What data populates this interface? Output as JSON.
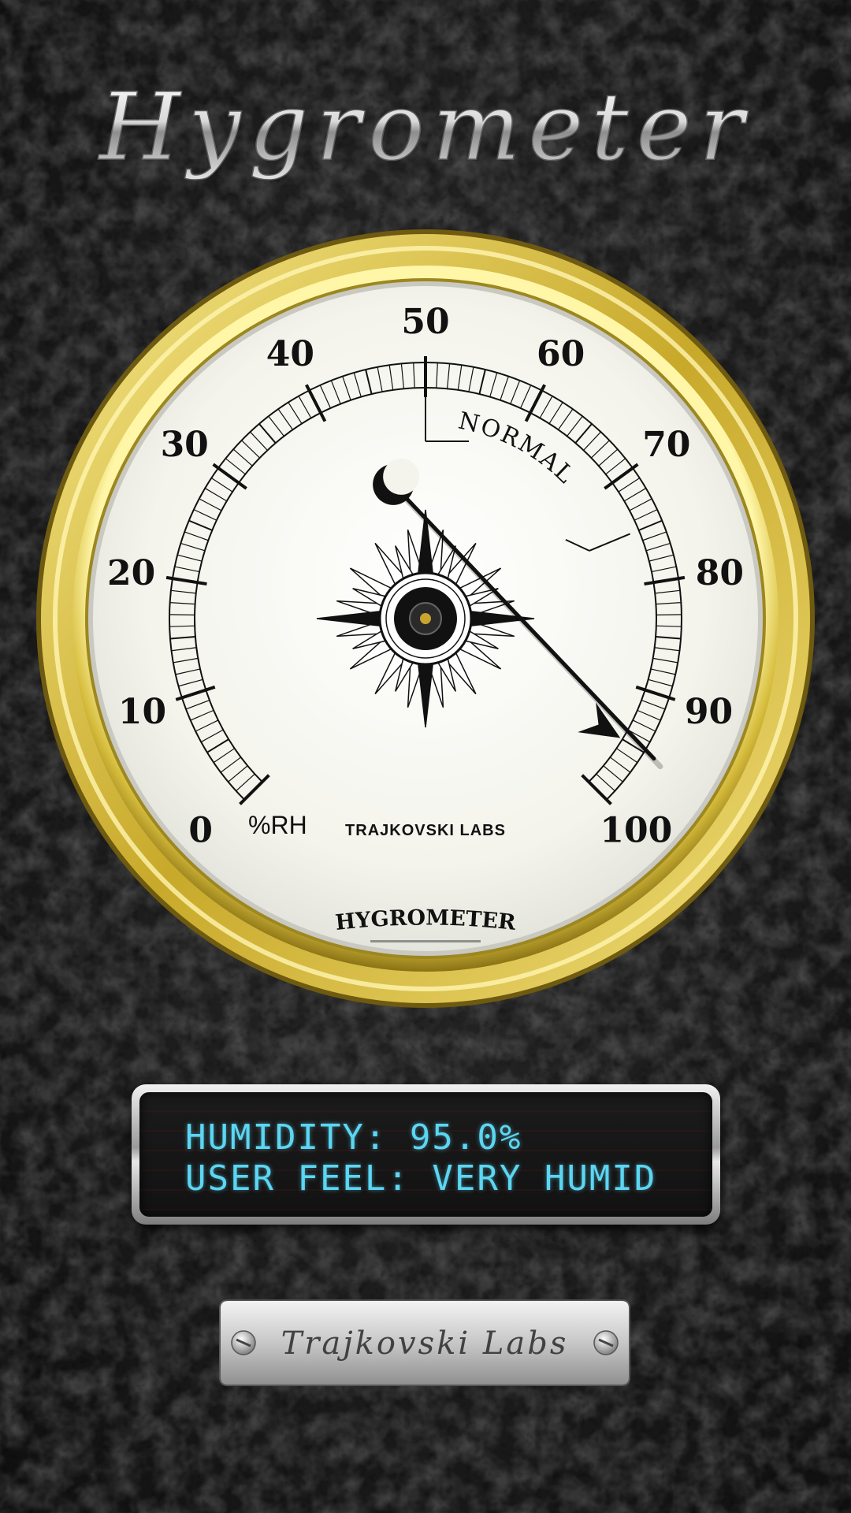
{
  "app": {
    "title": "Hygrometer"
  },
  "gauge": {
    "scale_labels": [
      "0",
      "10",
      "20",
      "30",
      "40",
      "50",
      "60",
      "70",
      "80",
      "90",
      "100"
    ],
    "unit_label": "%RH",
    "normal_label": "NORMAL",
    "brand_label": "TRAJKOVSKI LABS",
    "dial_title": "HYGROMETER",
    "humidity_value_percent": 95.0,
    "normal_range_percent": [
      50,
      75
    ]
  },
  "readout": {
    "line1": "HUMIDITY: 95.0%",
    "line2": "USER FEEL: VERY HUMID"
  },
  "footer": {
    "brand": "Trajkovski Labs"
  },
  "colors": {
    "lcd_text": "#5cd6f2",
    "bezel_gold": "#d8c24a",
    "dial_face": "#f4f4ec"
  }
}
